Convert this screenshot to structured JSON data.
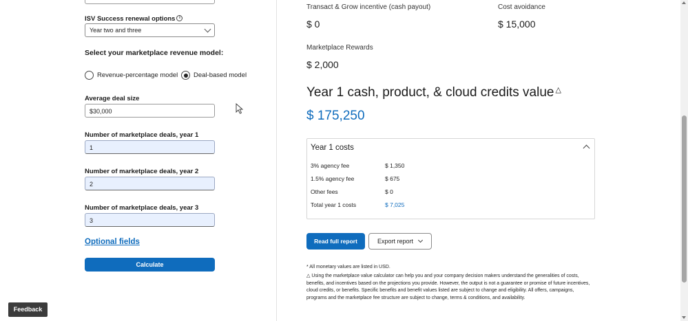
{
  "form": {
    "renewal_label": "ISV Success renewal options",
    "renewal_value": "Year two and three",
    "revenue_model_heading": "Select your marketplace revenue model:",
    "radio_revenue_percentage": "Revenue-percentage model",
    "radio_deal_based": "Deal-based model",
    "selected_model": "Deal-based model",
    "avg_deal_label": "Average deal size",
    "avg_deal_value": "$30,000",
    "deals_y1_label": "Number of marketplace deals, year 1",
    "deals_y1_value": "1",
    "deals_y2_label": "Number of marketplace deals, year 2",
    "deals_y2_value": "2",
    "deals_y3_label": "Number of marketplace deals, year 3",
    "deals_y3_value": "3",
    "optional_fields": "Optional fields",
    "calculate": "Calculate"
  },
  "results": {
    "transact_label": "Transact & Grow incentive (cash payout)",
    "transact_value": "$ 0",
    "cost_avoid_label": "Cost avoidance",
    "cost_avoid_value": "$ 15,000",
    "rewards_label": "Marketplace Rewards",
    "rewards_value": "$ 2,000",
    "year1_title": "Year 1 cash, product, & cloud credits value",
    "year1_value": "$ 175,250"
  },
  "costs": {
    "title": "Year 1 costs",
    "rows": [
      {
        "label": "3% agency fee",
        "value": "$ 1,350"
      },
      {
        "label": "1.5% agency fee",
        "value": "$ 675"
      },
      {
        "label": "Other fees",
        "value": "$ 0"
      },
      {
        "label": "Total year 1 costs",
        "value": "$ 7,025"
      }
    ]
  },
  "actions": {
    "read_report": "Read full report",
    "export_report": "Export report"
  },
  "footnotes": {
    "usd": "* All monetary values are listed in USD.",
    "disclaimer": "Using the marketplace value calculator can help you and your company decision makers understand the generalities of costs, benefits, and incentives based on the projections you provide. However, the output is not a guarantee or promise of future incentives, cloud credits, or benefits. Specific benefits and benefit values listed are subject to change and eligibility. All offers, campaigns, programs and the marketplace fee structure are subject to change, terms & conditions, and availability."
  },
  "feedback": "Feedback",
  "icons": {
    "info": "info-icon",
    "triangle": "warning-triangle-icon",
    "chevron": "chevron-icon"
  },
  "colors": {
    "accent": "#0f6cbd",
    "input_fill": "#e8f0fe"
  }
}
